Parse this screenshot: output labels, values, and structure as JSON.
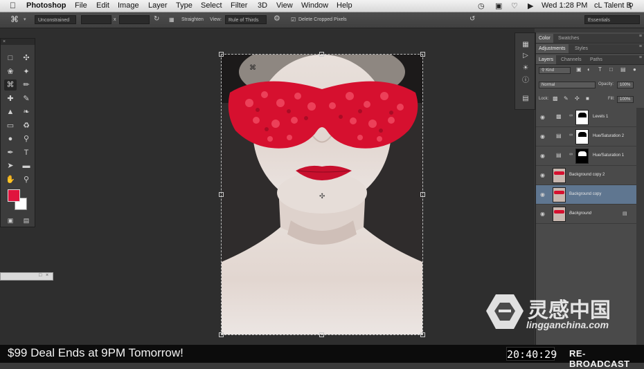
{
  "menubar": {
    "apple_icon": "apple-icon",
    "app_name": "Photoshop",
    "menus": [
      "File",
      "Edit",
      "Image",
      "Layer",
      "Type",
      "Select",
      "Filter",
      "3D",
      "View",
      "Window",
      "Help"
    ],
    "clock": "Wed 1:28 PM",
    "user": "cL Talent B"
  },
  "options_bar": {
    "ratio": "Unconstrained",
    "x_sep": "x",
    "straighten": "Straighten",
    "view_label": "View:",
    "view_value": "Rule of Thirds",
    "delete_cropped": "Delete Cropped Pixels",
    "delete_cropped_checked": true,
    "workspace": "Essentials"
  },
  "colors": {
    "foreground": "#e0143e",
    "background": "#ffffff",
    "selected_layer": "#5f7690"
  },
  "panels": {
    "top_tabs": [
      "Color",
      "Swatches"
    ],
    "adjust_tabs": [
      "Adjustments",
      "Styles"
    ],
    "layer_tabs": [
      "Layers",
      "Channels",
      "Paths"
    ],
    "kind": "Kind",
    "blend_mode": "Normal",
    "opacity_label": "Opacity:",
    "opacity": "100%",
    "lock_label": "Lock:",
    "fill_label": "Fill:",
    "fill": "100%",
    "layers": [
      {
        "name": "Levels 1",
        "type": "adjustment"
      },
      {
        "name": "Hue/Saturation 2",
        "type": "adjustment"
      },
      {
        "name": "Hue/Saturation 1",
        "type": "adjustment"
      },
      {
        "name": "Background copy 2",
        "type": "image"
      },
      {
        "name": "Background copy",
        "type": "image",
        "selected": true
      },
      {
        "name": "Background",
        "type": "image",
        "locked": true
      }
    ]
  },
  "ticker": {
    "message": "$99 Deal Ends at 9PM Tomorrow!",
    "time": "20:40:29",
    "label": "RE-BROADCAST"
  },
  "watermark": {
    "name": "灵感中国",
    "url": "lingganchina.com"
  }
}
